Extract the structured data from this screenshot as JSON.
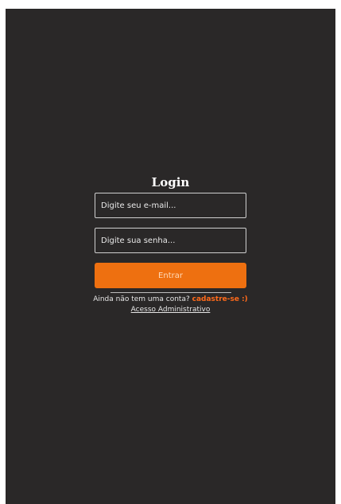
{
  "login": {
    "title": "Login",
    "email_placeholder": "Digite seu e-mail...",
    "password_placeholder": "Digite sua senha...",
    "submit_label": "Entrar",
    "no_account_text": "Ainda não tem uma conta?",
    "signup_link": "cadastre-se :)",
    "admin_link": "Acesso Administrativo"
  },
  "colors": {
    "background": "#2a2828",
    "accent": "#ee7010",
    "link": "#ff6a1a"
  }
}
